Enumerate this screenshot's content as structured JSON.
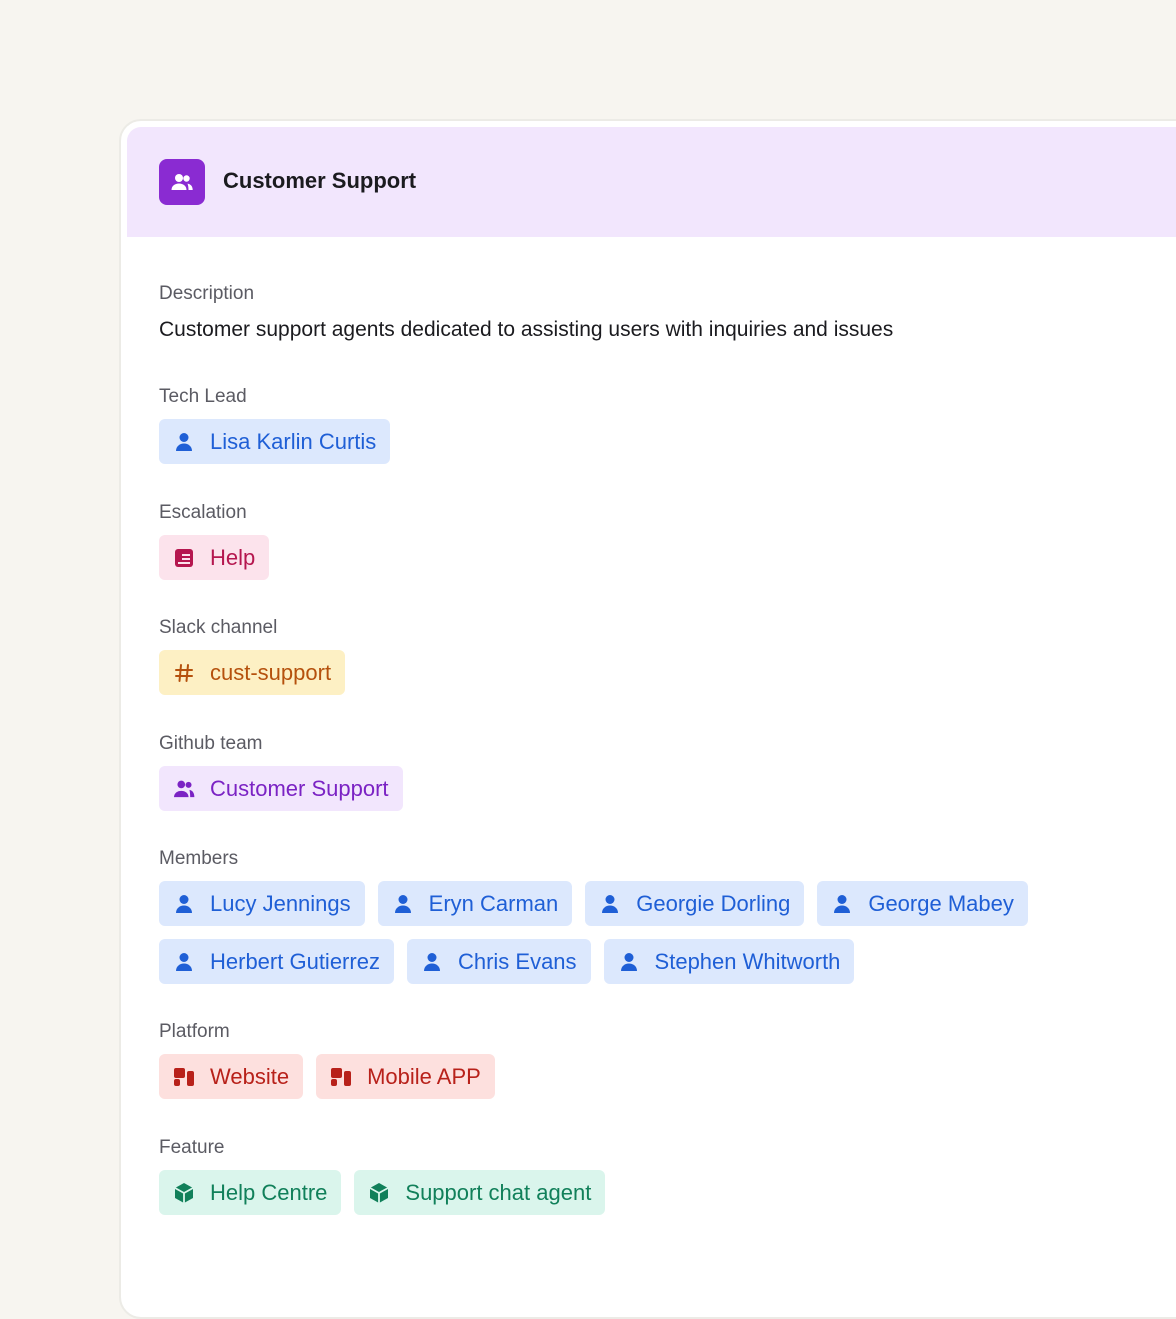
{
  "header": {
    "title": "Customer Support",
    "icon": "users-icon"
  },
  "description": {
    "label": "Description",
    "text": "Customer support agents dedicated to assisting users with inquiries and issues"
  },
  "tech_lead": {
    "label": "Tech Lead",
    "value": "Lisa Karlin Curtis"
  },
  "escalation": {
    "label": "Escalation",
    "value": "Help"
  },
  "slack": {
    "label": "Slack channel",
    "value": "cust-support"
  },
  "github": {
    "label": "Github team",
    "value": "Customer Support"
  },
  "members": {
    "label": "Members",
    "items": [
      "Lucy Jennings",
      "Eryn Carman",
      "Georgie Dorling",
      "George Mabey",
      "Herbert Gutierrez",
      "Chris Evans",
      "Stephen Whitworth"
    ]
  },
  "platform": {
    "label": "Platform",
    "items": [
      "Website",
      "Mobile APP"
    ]
  },
  "feature": {
    "label": "Feature",
    "items": [
      "Help Centre",
      "Support chat agent"
    ]
  },
  "colors": {
    "header_bg": "#f2e6fd",
    "accent_purple": "#8a2bd2",
    "person_blue": "#1f5fd6",
    "escalation_pink": "#b5174f",
    "slack_orange": "#b5510d",
    "platform_red": "#b8211a",
    "feature_green": "#11805a"
  }
}
